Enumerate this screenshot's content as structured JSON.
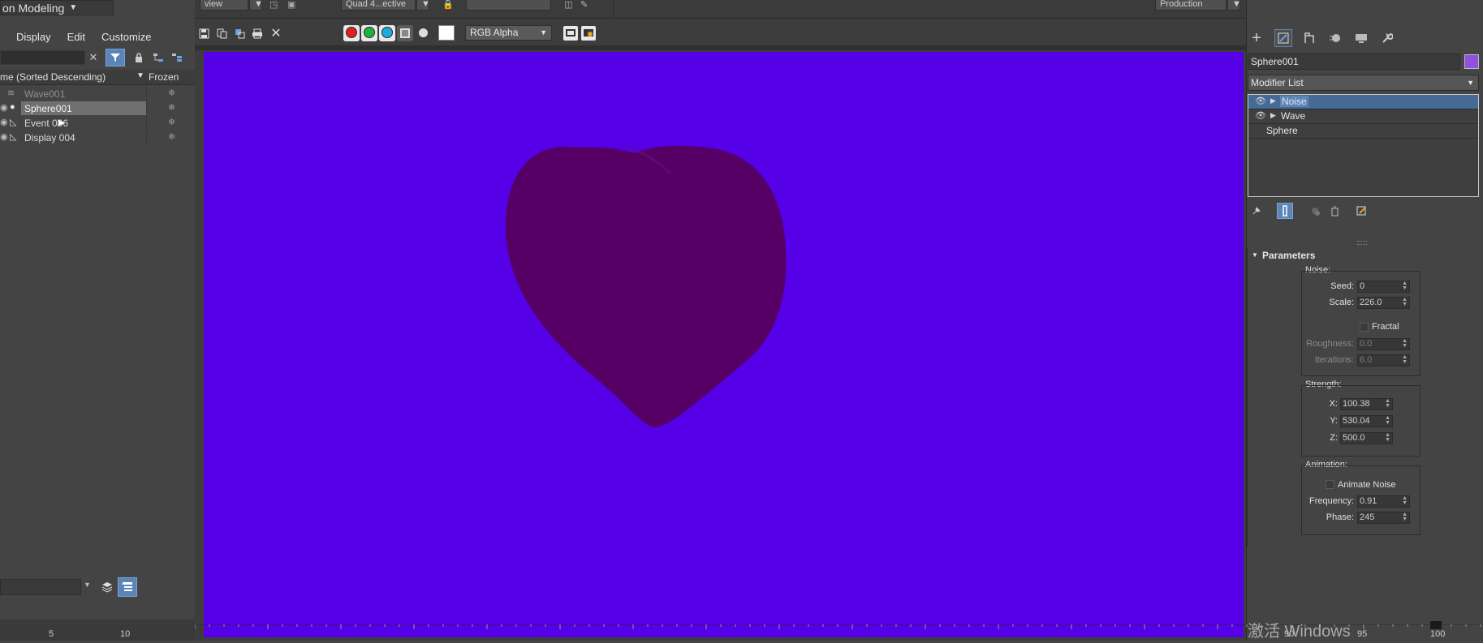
{
  "left_panel": {
    "workspace_label": "on Modeling",
    "menu": [
      "Display",
      "Edit",
      "Customize"
    ],
    "columns": {
      "name": "me (Sorted Descending)",
      "frozen": "Frozen"
    },
    "rows": [
      {
        "name": "Wave001",
        "dimmed": true
      },
      {
        "name": "Sphere001",
        "selected": true
      },
      {
        "name": "Event 006"
      },
      {
        "name": "Display 004"
      }
    ]
  },
  "top_strip": {
    "view_label": "view",
    "quad_label": "Quad 4...ective",
    "production_label": "Production"
  },
  "render_frame": {
    "channel_dropdown": "RGB Alpha",
    "background_color": "#5500e6",
    "object_color": "#560066"
  },
  "command_panel": {
    "object_name": "Sphere001",
    "object_color": "#9050e0",
    "modifier_list_label": "Modifier List",
    "stack": [
      {
        "label": "Noise",
        "active": true
      },
      {
        "label": "Wave"
      },
      {
        "label": "Sphere"
      }
    ],
    "rollout_title": "Parameters",
    "noise": {
      "group_label": "Noise:",
      "seed_label": "Seed:",
      "seed": "0",
      "scale_label": "Scale:",
      "scale": "226.0",
      "fractal_label": "Fractal",
      "roughness_label": "Roughness:",
      "roughness": "0.0",
      "iterations_label": "Iterations:",
      "iterations": "6.0"
    },
    "strength": {
      "group_label": "Strength:",
      "x_label": "X:",
      "x": "100.38",
      "y_label": "Y:",
      "y": "530.04",
      "z_label": "Z:",
      "z": "500.0"
    },
    "animation": {
      "group_label": "Animation:",
      "animate_label": "Animate Noise",
      "frequency_label": "Frequency:",
      "frequency": "0.91",
      "phase_label": "Phase:",
      "phase": "245"
    }
  },
  "timeline": {
    "left_ticks": [
      "5",
      "10"
    ],
    "right_ticks": [
      "90",
      "95",
      "100"
    ]
  },
  "watermark": "激活 Windows"
}
